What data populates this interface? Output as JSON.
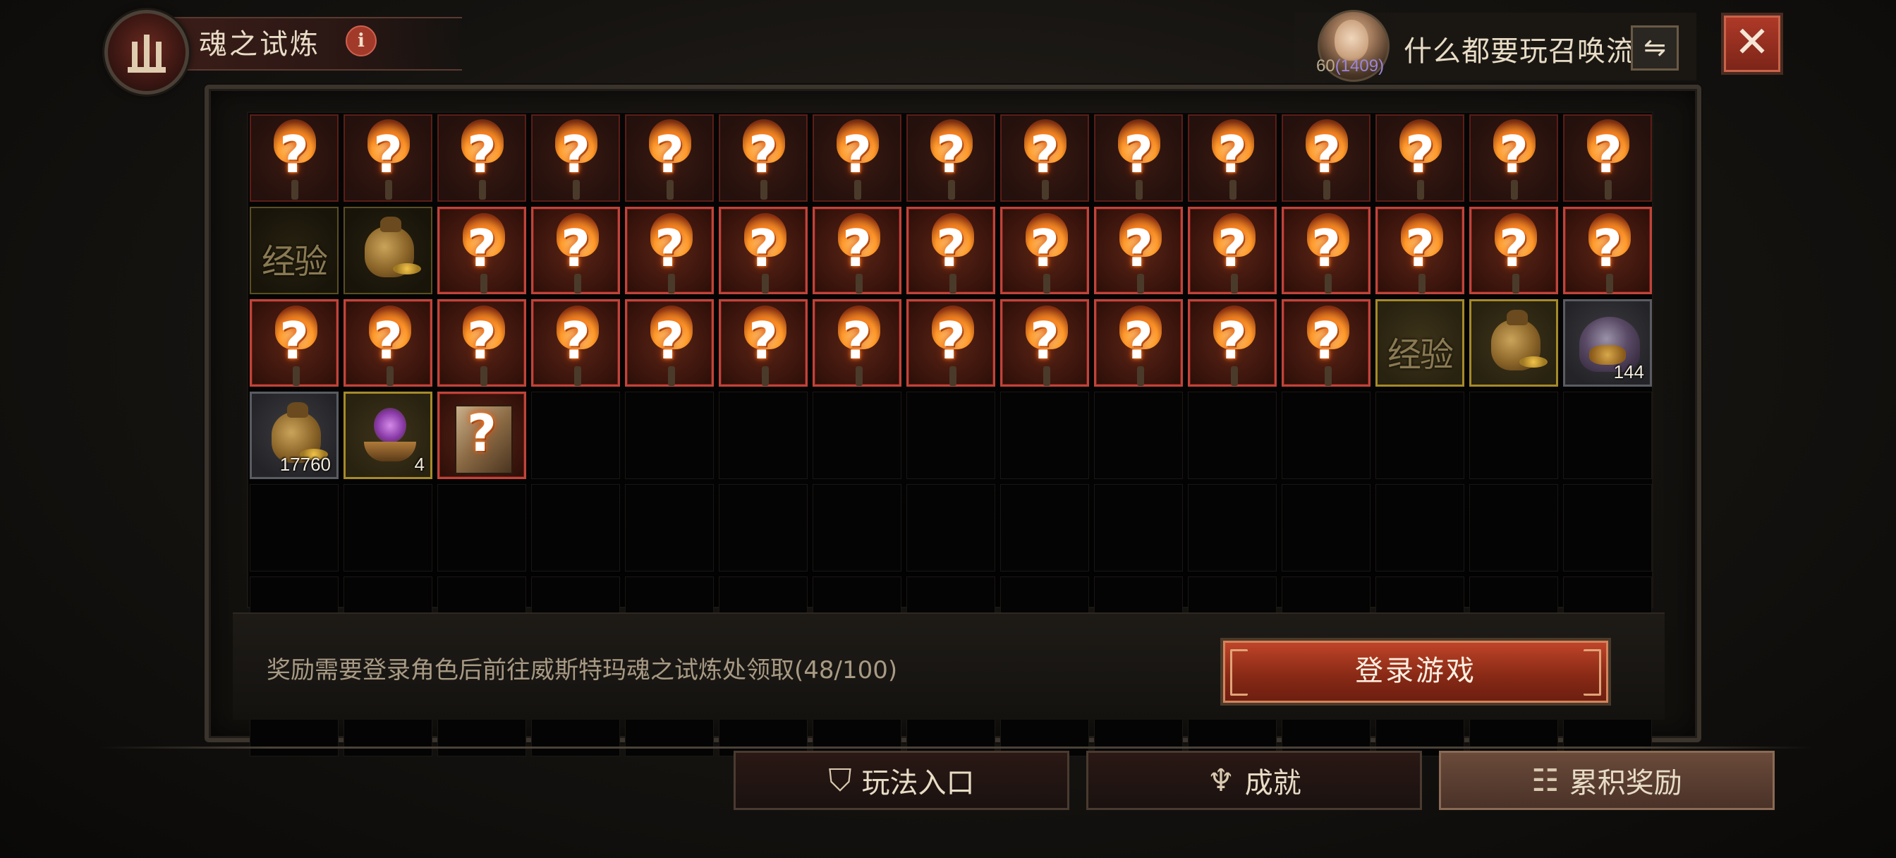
{
  "header": {
    "title": "魂之试炼",
    "info_icon": "info-icon",
    "emblem_icon": "gate-emblem-icon"
  },
  "player": {
    "level": "60",
    "power": "(1409)",
    "name": "什么都要玩召唤流",
    "switch_icon": "swap-icon",
    "switch_glyph": "⇋"
  },
  "close_button": {
    "icon": "close-icon",
    "glyph": "✕"
  },
  "rewards": {
    "rows": [
      [
        "mystery",
        "mystery",
        "mystery",
        "mystery",
        "mystery",
        "mystery",
        "mystery",
        "mystery",
        "mystery",
        "mystery",
        "mystery",
        "mystery",
        "mystery",
        "mystery",
        "mystery"
      ],
      [
        "exp",
        "gold_bag",
        "mystery",
        "mystery",
        "mystery",
        "mystery",
        "mystery",
        "mystery",
        "mystery",
        "mystery",
        "mystery",
        "mystery",
        "mystery",
        "mystery",
        "mystery"
      ],
      [
        "mystery",
        "mystery",
        "mystery",
        "mystery",
        "mystery",
        "mystery",
        "mystery",
        "mystery",
        "mystery",
        "mystery",
        "mystery",
        "mystery",
        "exp",
        "gold_bag",
        "helmet"
      ],
      [
        "gold_bag_grey",
        "brazier",
        "chest_mystery"
      ]
    ],
    "mystery_glyph": "?",
    "exp_label": "经验",
    "counts": {
      "helmet": "144",
      "gold_bag_grey": "17760",
      "brazier": "4"
    },
    "total_rows": 7,
    "columns": 15
  },
  "footer": {
    "hint": "奖励需要登录角色后前往威斯特玛魂之试炼处领取(48/100)",
    "login_button": "登录游戏"
  },
  "tabs": [
    {
      "label": "玩法入口",
      "icon": "shield-icon",
      "glyph": "⛉",
      "active": false
    },
    {
      "label": "成就",
      "icon": "trophy-icon",
      "glyph": "♆",
      "active": false
    },
    {
      "label": "累积奖励",
      "icon": "chest-icon",
      "glyph": "☷",
      "active": true
    }
  ]
}
